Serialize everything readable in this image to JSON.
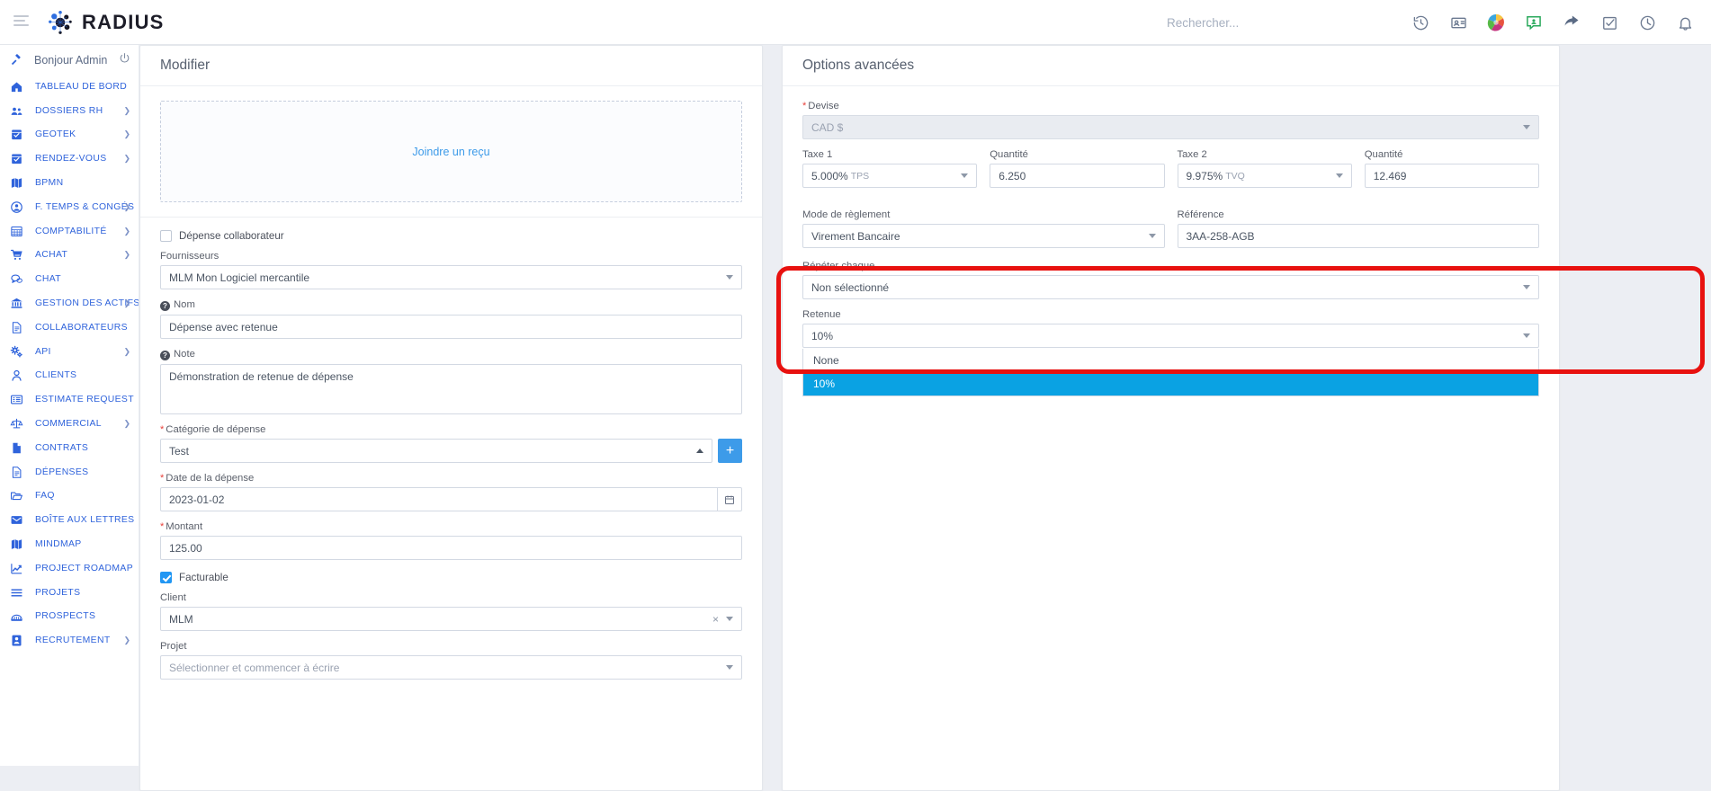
{
  "app": {
    "brand": "RADIUS",
    "hamburger_icon": "hamburger-menu-icon"
  },
  "search": {
    "placeholder": "Rechercher...",
    "value": ""
  },
  "topbar_icons": [
    {
      "name": "history-icon",
      "label": "Historique"
    },
    {
      "name": "contact-card-icon",
      "label": "Carte de contact"
    },
    {
      "name": "globe-icon",
      "label": "Langue"
    },
    {
      "name": "chat-support-icon",
      "label": "Support"
    },
    {
      "name": "share-arrow-icon",
      "label": "Partager"
    },
    {
      "name": "checkbox-task-icon",
      "label": "Tâches"
    },
    {
      "name": "clock-icon",
      "label": "Temps"
    },
    {
      "name": "bell-icon",
      "label": "Notifications"
    }
  ],
  "sidebar": {
    "greeting": "Bonjour Admin",
    "greeting_icon": "gavel-icon",
    "logout_icon": "power-off-icon",
    "items": [
      {
        "label": "TABLEAU DE BORD",
        "icon": "home-icon",
        "chevron": false
      },
      {
        "label": "DOSSIERS RH",
        "icon": "users-icon",
        "chevron": true
      },
      {
        "label": "GEOTEK",
        "icon": "calendar-icon",
        "chevron": true
      },
      {
        "label": "RENDEZ-VOUS",
        "icon": "calendar-icon",
        "chevron": true
      },
      {
        "label": "BPMN",
        "icon": "map-icon",
        "chevron": false
      },
      {
        "label": "F. TEMPS & CONGÉS",
        "icon": "user-circle-icon",
        "chevron": true
      },
      {
        "label": "COMPTABILITÉ",
        "icon": "table-icon",
        "chevron": true
      },
      {
        "label": "ACHAT",
        "icon": "cart-icon",
        "chevron": true
      },
      {
        "label": "CHAT",
        "icon": "chat-bubble-icon",
        "chevron": false
      },
      {
        "label": "GESTION DES ACTIFS",
        "icon": "bank-icon",
        "chevron": true
      },
      {
        "label": "COLLABORATEURS",
        "icon": "document-icon",
        "chevron": false
      },
      {
        "label": "API",
        "icon": "gears-icon",
        "chevron": true
      },
      {
        "label": "CLIENTS",
        "icon": "person-icon",
        "chevron": false
      },
      {
        "label": "ESTIMATE REQUEST",
        "icon": "list-icon",
        "chevron": false
      },
      {
        "label": "COMMERCIAL",
        "icon": "scales-icon",
        "chevron": true
      },
      {
        "label": "CONTRATS",
        "icon": "file-icon",
        "chevron": false
      },
      {
        "label": "DÉPENSES",
        "icon": "document-icon",
        "chevron": false
      },
      {
        "label": "FAQ",
        "icon": "folder-icon",
        "chevron": false
      },
      {
        "label": "BOÎTE AUX LETTRES",
        "icon": "envelope-icon",
        "chevron": false
      },
      {
        "label": "MINDMAP",
        "icon": "map-icon",
        "chevron": false
      },
      {
        "label": "PROJECT ROADMAP",
        "icon": "chart-line-icon",
        "chevron": false
      },
      {
        "label": "PROJETS",
        "icon": "bars-icon",
        "chevron": false
      },
      {
        "label": "PROSPECTS",
        "icon": "building-icon",
        "chevron": false
      },
      {
        "label": "RECRUTEMENT",
        "icon": "user-badge-icon",
        "chevron": true
      }
    ]
  },
  "left_panel": {
    "title": "Modifier",
    "attach_link": "Joindre un reçu",
    "employee_expense": {
      "label": "Dépense collaborateur",
      "checked": false
    },
    "fournisseurs": {
      "label": "Fournisseurs",
      "value": "MLM Mon Logiciel mercantile"
    },
    "nom": {
      "label": "Nom",
      "value": "Dépense avec retenue"
    },
    "note": {
      "label": "Note",
      "value": "Démonstration de retenue de dépense"
    },
    "categorie": {
      "label": "Catégorie de dépense",
      "value": "Test",
      "required": true,
      "add_button": "+"
    },
    "date": {
      "label": "Date de la dépense",
      "value": "2023-01-02",
      "required": true
    },
    "montant": {
      "label": "Montant",
      "value": "125.00",
      "required": true
    },
    "facturable": {
      "label": "Facturable",
      "checked": true
    },
    "client": {
      "label": "Client",
      "value": "MLM"
    },
    "projet": {
      "label": "Projet",
      "placeholder": "Sélectionner et commencer à écrire",
      "value": ""
    }
  },
  "right_panel": {
    "title": "Options avancées",
    "devise": {
      "label": "Devise",
      "value": "CAD $",
      "required": true,
      "disabled": true
    },
    "taxe1": {
      "label": "Taxe 1",
      "value": "5.000%",
      "suffix": "TPS"
    },
    "quantite1": {
      "label": "Quantité",
      "value": "6.250"
    },
    "taxe2": {
      "label": "Taxe 2",
      "value": "9.975%",
      "suffix": "TVQ"
    },
    "quantite2": {
      "label": "Quantité",
      "value": "12.469"
    },
    "mode_reglement": {
      "label": "Mode de règlement",
      "value": "Virement Bancaire"
    },
    "reference": {
      "label": "Référence",
      "value": "3AA-258-AGB"
    },
    "repeter": {
      "label": "Répéter chaque",
      "value": "Non sélectionné"
    },
    "retenue": {
      "label": "Retenue",
      "value": "10%",
      "open": true,
      "options": [
        {
          "label": "None",
          "selected": false
        },
        {
          "label": "10%",
          "selected": true
        }
      ]
    }
  },
  "annotation": {
    "name": "red-highlight-box",
    "color": "#e8110f"
  }
}
